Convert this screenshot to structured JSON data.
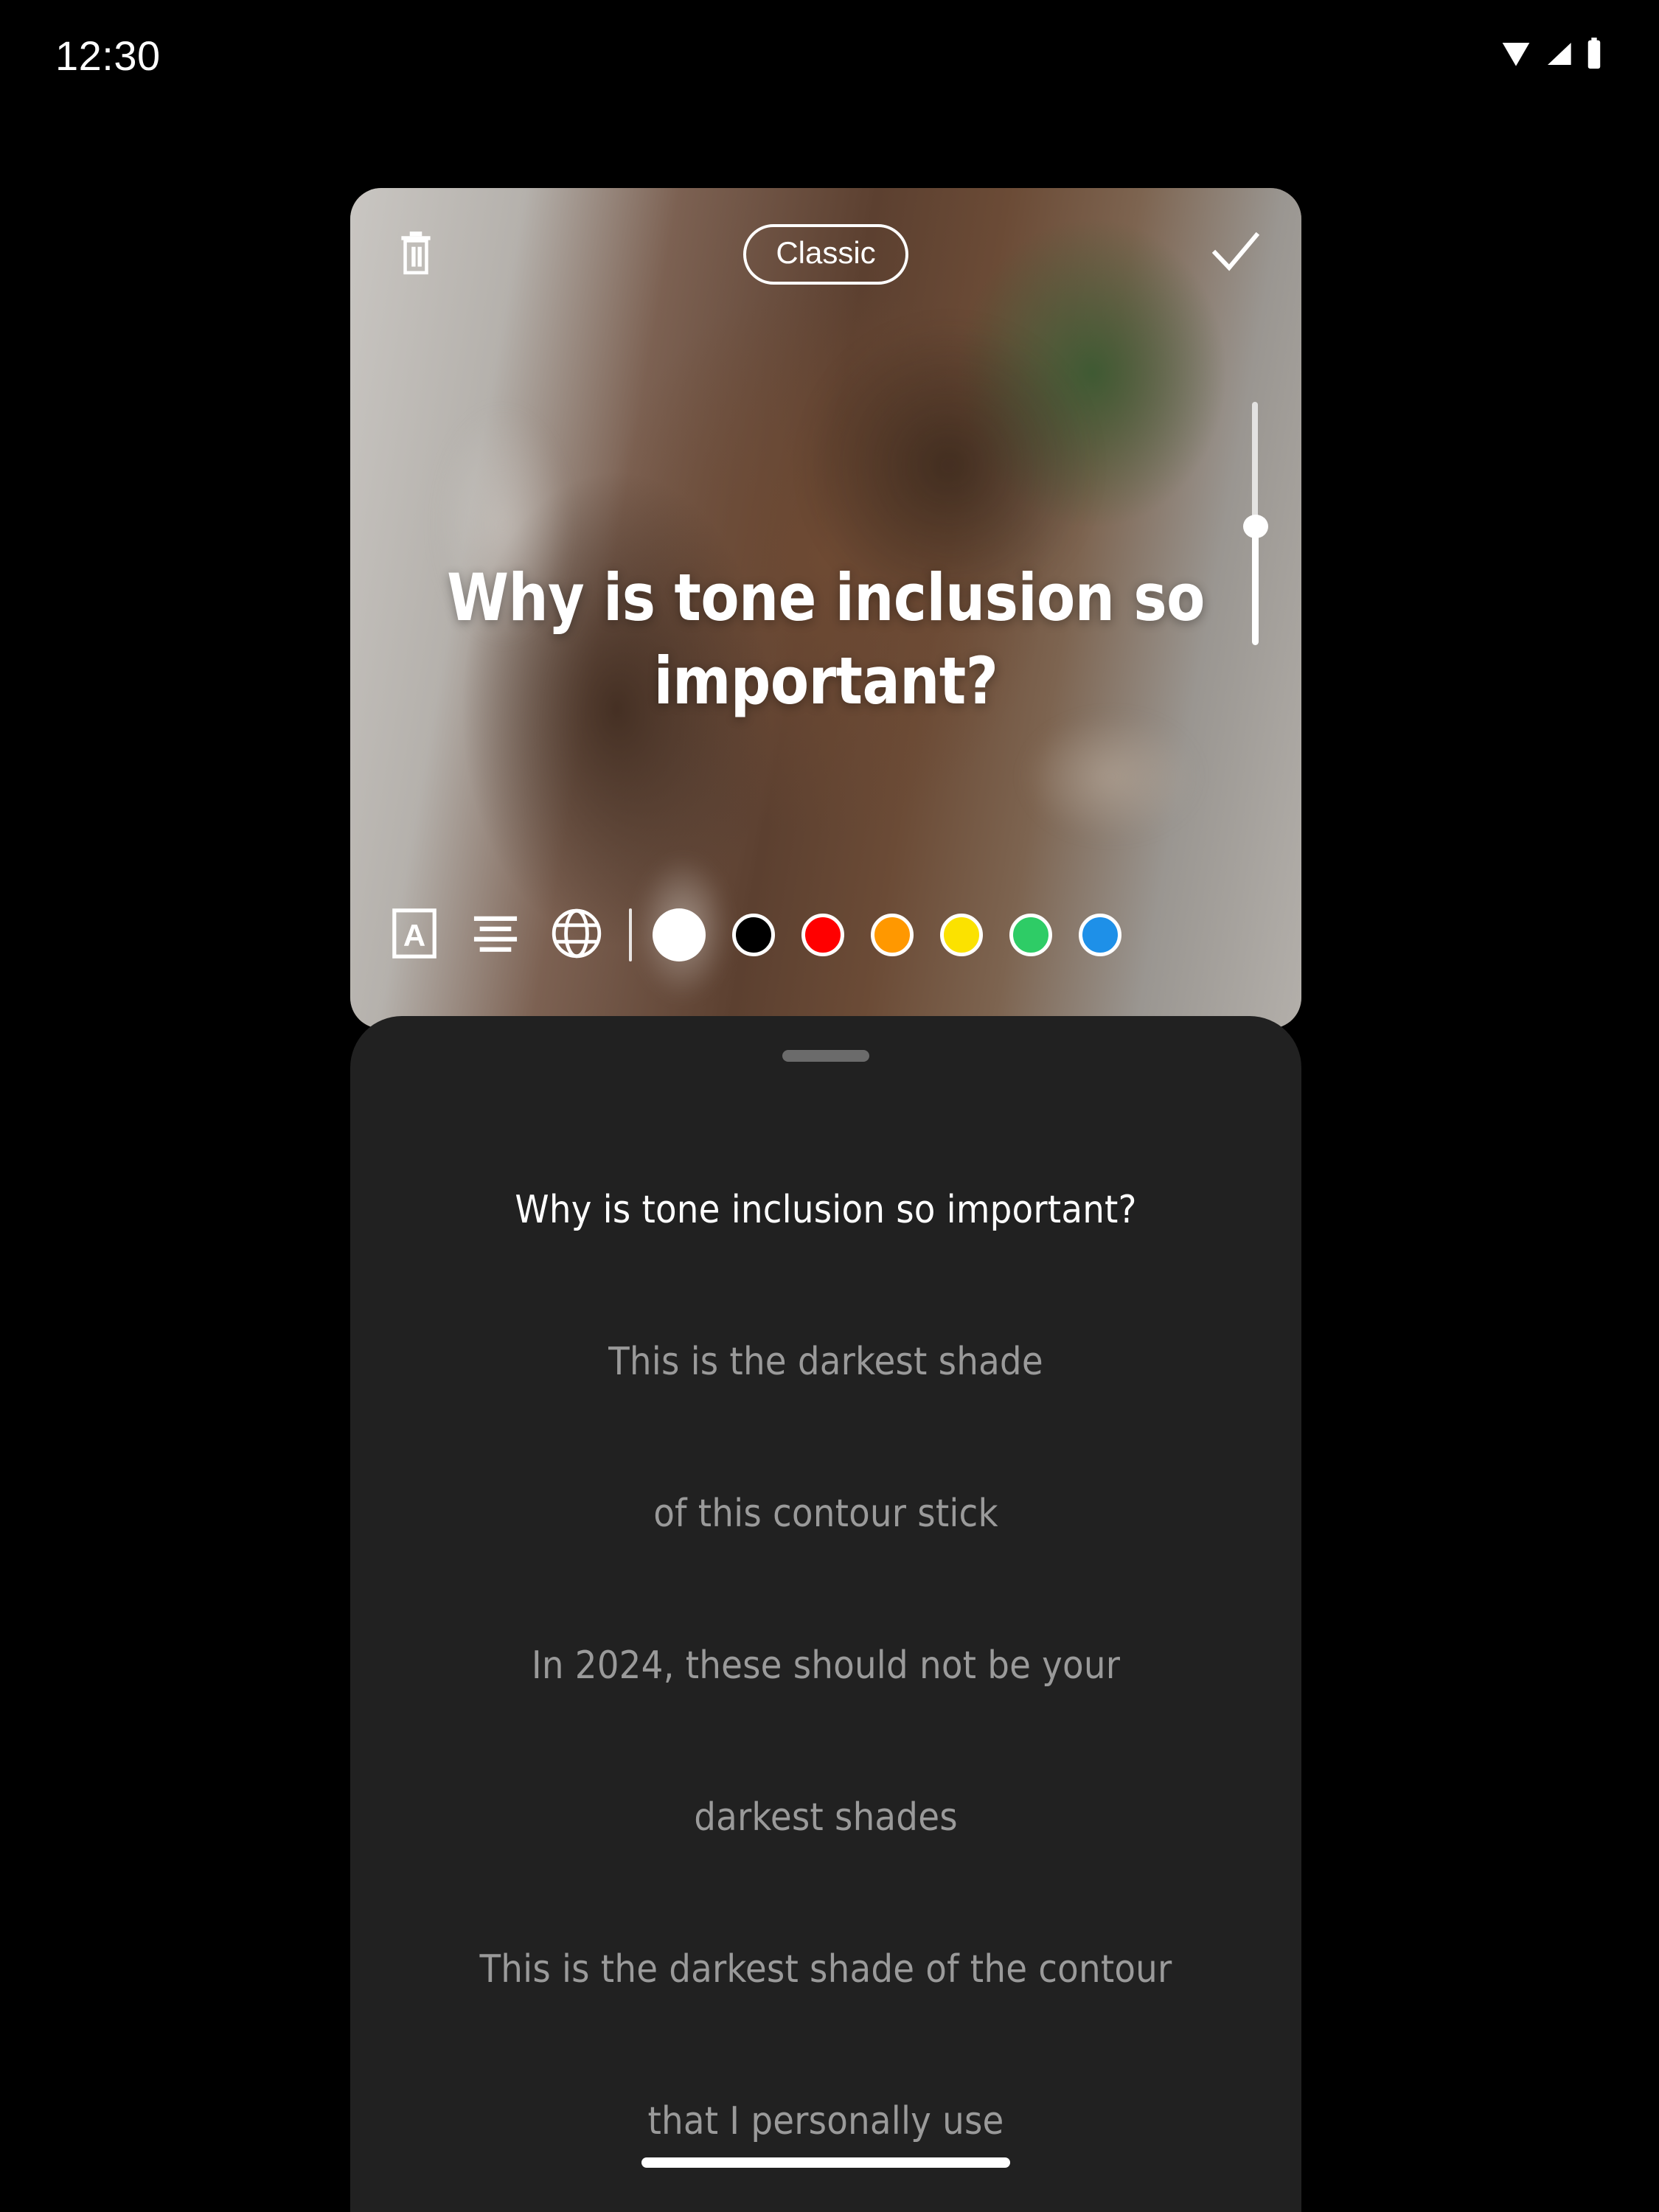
{
  "status_bar": {
    "time": "12:30",
    "icons": [
      "wifi-icon",
      "cellular-signal-icon",
      "battery-icon"
    ]
  },
  "media_toolbar": {
    "delete_icon": "trash-icon",
    "font_style_label": "Classic",
    "confirm_icon": "check-icon"
  },
  "overlay_caption": {
    "text": "Why is tone inclusion so important?",
    "color": "#FFFFFF"
  },
  "size_slider": {
    "name": "text-size-slider",
    "value_percent": 50
  },
  "text_tools": [
    {
      "name": "text-background-icon",
      "glyph": "A"
    },
    {
      "name": "text-align-center-icon",
      "glyph": "align"
    },
    {
      "name": "translate-globe-icon",
      "glyph": "globe"
    }
  ],
  "color_swatches": [
    {
      "name": "color-white",
      "hex": "#FFFFFF",
      "selected": true
    },
    {
      "name": "color-black",
      "hex": "#000000",
      "selected": false
    },
    {
      "name": "color-red",
      "hex": "#FF0000",
      "selected": false
    },
    {
      "name": "color-orange",
      "hex": "#FF9800",
      "selected": false
    },
    {
      "name": "color-yellow",
      "hex": "#FBE200",
      "selected": false
    },
    {
      "name": "color-green",
      "hex": "#2ECC66",
      "selected": false
    },
    {
      "name": "color-blue",
      "hex": "#1E90E8",
      "selected": false
    }
  ],
  "bottom_sheet": {
    "handle": "drag-handle",
    "transcript_lines": [
      {
        "text": "Why is tone inclusion so important?",
        "active": true
      },
      {
        "text": "This is the darkest shade",
        "active": false
      },
      {
        "text": "of this contour stick",
        "active": false
      },
      {
        "text": "In 2024, these should not be your",
        "active": false
      },
      {
        "text": "darkest shades",
        "active": false
      },
      {
        "text": "This is the darkest shade of the contour",
        "active": false
      },
      {
        "text": "that I personally use",
        "active": false
      }
    ],
    "home_indicator": "home-indicator"
  }
}
